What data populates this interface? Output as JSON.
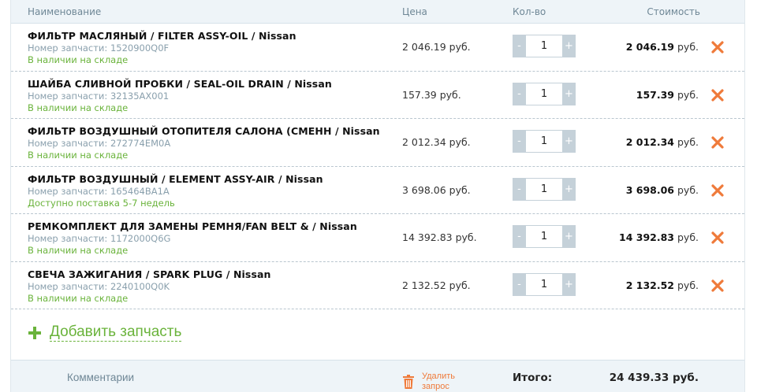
{
  "header": {
    "name": "Наименование",
    "price": "Цена",
    "qty": "Кол-во",
    "cost": "Стоимость"
  },
  "items": [
    {
      "title": "ФИЛЬТР МАСЛЯНЫЙ / FILTER ASSY-OIL / Nissan",
      "part": "Номер запчасти: 1520900Q0F",
      "availability": "В наличии на складе",
      "price": "2 046.19 руб.",
      "qty": "1",
      "cost": "2 046.19",
      "cost_unit": "руб."
    },
    {
      "title": "ШАЙБА СЛИВНОЙ ПРОБКИ / SEAL-OIL DRAIN / Nissan",
      "part": "Номер запчасти: 32135AX001",
      "availability": "В наличии на складе",
      "price": "157.39 руб.",
      "qty": "1",
      "cost": "157.39",
      "cost_unit": "руб."
    },
    {
      "title": "ФИЛЬТР ВОЗДУШНЫЙ ОТОПИТЕЛЯ САЛОНА (СМЕНН / Nissan",
      "part": "Номер запчасти: 272774EM0A",
      "availability": "В наличии на складе",
      "price": "2 012.34 руб.",
      "qty": "1",
      "cost": "2 012.34",
      "cost_unit": "руб."
    },
    {
      "title": "ФИЛЬТР ВОЗДУШНЫЙ / ELEMENT ASSY-AIR / Nissan",
      "part": "Номер запчасти: 165464BA1A",
      "availability": "Доступно поставка 5-7 недель",
      "price": "3 698.06 руб.",
      "qty": "1",
      "cost": "3 698.06",
      "cost_unit": "руб."
    },
    {
      "title": "РЕМКОМПЛЕКТ ДЛЯ ЗАМЕНЫ РЕМНЯ/FAN BELT & / Nissan",
      "part": "Номер запчасти: 1172000Q6G",
      "availability": "В наличии на складе",
      "price": "14 392.83 руб.",
      "qty": "1",
      "cost": "14 392.83",
      "cost_unit": "руб."
    },
    {
      "title": "СВЕЧА ЗАЖИГАНИЯ / SPARK PLUG / Nissan",
      "part": "Номер запчасти: 2240100Q0K",
      "availability": "В наличии на складе",
      "price": "2 132.52 руб.",
      "qty": "1",
      "cost": "2 132.52",
      "cost_unit": "руб."
    }
  ],
  "qty_controls": {
    "minus": "-",
    "plus": "+"
  },
  "icons": {
    "remove": "close-x-icon",
    "add": "plus-icon",
    "delete": "trash-icon"
  },
  "colors": {
    "accent_green": "#6ab33b",
    "remove_orange": "#ef7a3a",
    "header_bg": "#eef4f8"
  },
  "add_part": {
    "label": "Добавить запчасть"
  },
  "footer": {
    "comments": "Комментарии",
    "delete_request": "Удалить запрос",
    "total_label": "Итого:",
    "total_value": "24 439.33 руб."
  }
}
